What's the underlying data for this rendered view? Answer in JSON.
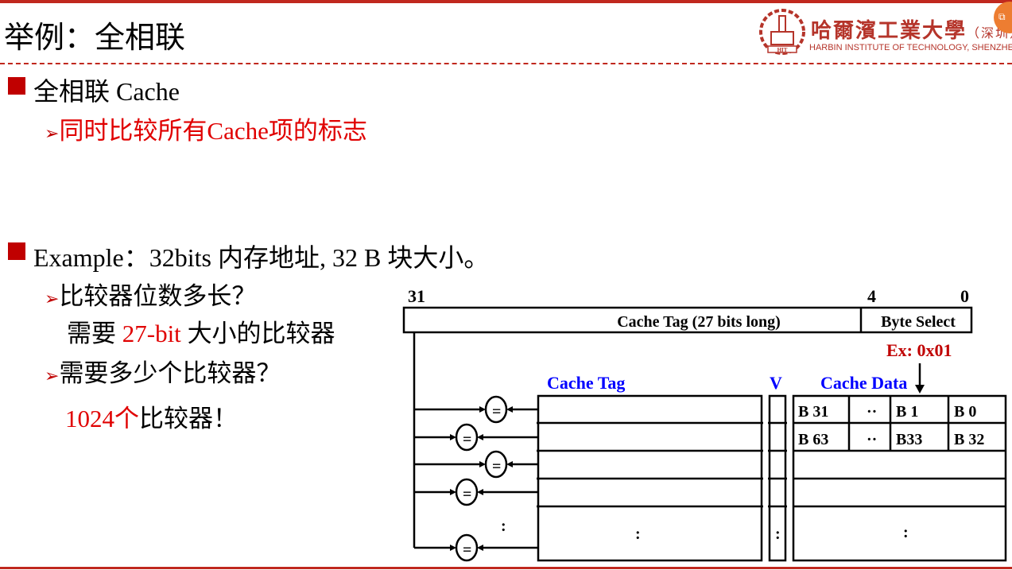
{
  "header": {
    "title": "举例：全相联",
    "logo": {
      "cn": "哈爾濱工業大學",
      "cn_suffix": "（深圳）",
      "en": "HARBIN INSTITUTE OF TECHNOLOGY, SHENZHEN",
      "year": "1920",
      "abbr": "HIT"
    },
    "badge_icon": "slide-copy-icon"
  },
  "bullets": [
    {
      "text": "全相联 Cache",
      "sub": [
        {
          "text": "同时比较所有Cache项的标志"
        }
      ]
    },
    {
      "text": "Example：32bits 内存地址, 32 B 块大小。",
      "sub": [
        {
          "text": "比较器位数多长？"
        },
        {
          "pre": "需要 ",
          "highlight": "27-bit",
          "post": " 大小的比较器"
        },
        {
          "text": "需要多少个比较器？"
        },
        {
          "highlight": "1024个",
          "post": "比较器！"
        }
      ]
    }
  ],
  "diagram": {
    "bit_high": "31",
    "bit_mid": "4",
    "bit_low": "0",
    "address_tag": "Cache Tag (27 bits long)",
    "address_byte": "Byte Select",
    "example": "Ex: 0x01",
    "col_tag": "Cache Tag",
    "col_valid": "V",
    "col_data": "Cache Data",
    "row0": [
      "B 31",
      "··",
      "B 1",
      "B 0"
    ],
    "row1": [
      "B 63",
      "··",
      "B33",
      "B 32"
    ],
    "ellipsis": ":",
    "comparator": "=",
    "colors": {
      "label_blue": "#0000ff",
      "example_red": "#c00000"
    }
  }
}
